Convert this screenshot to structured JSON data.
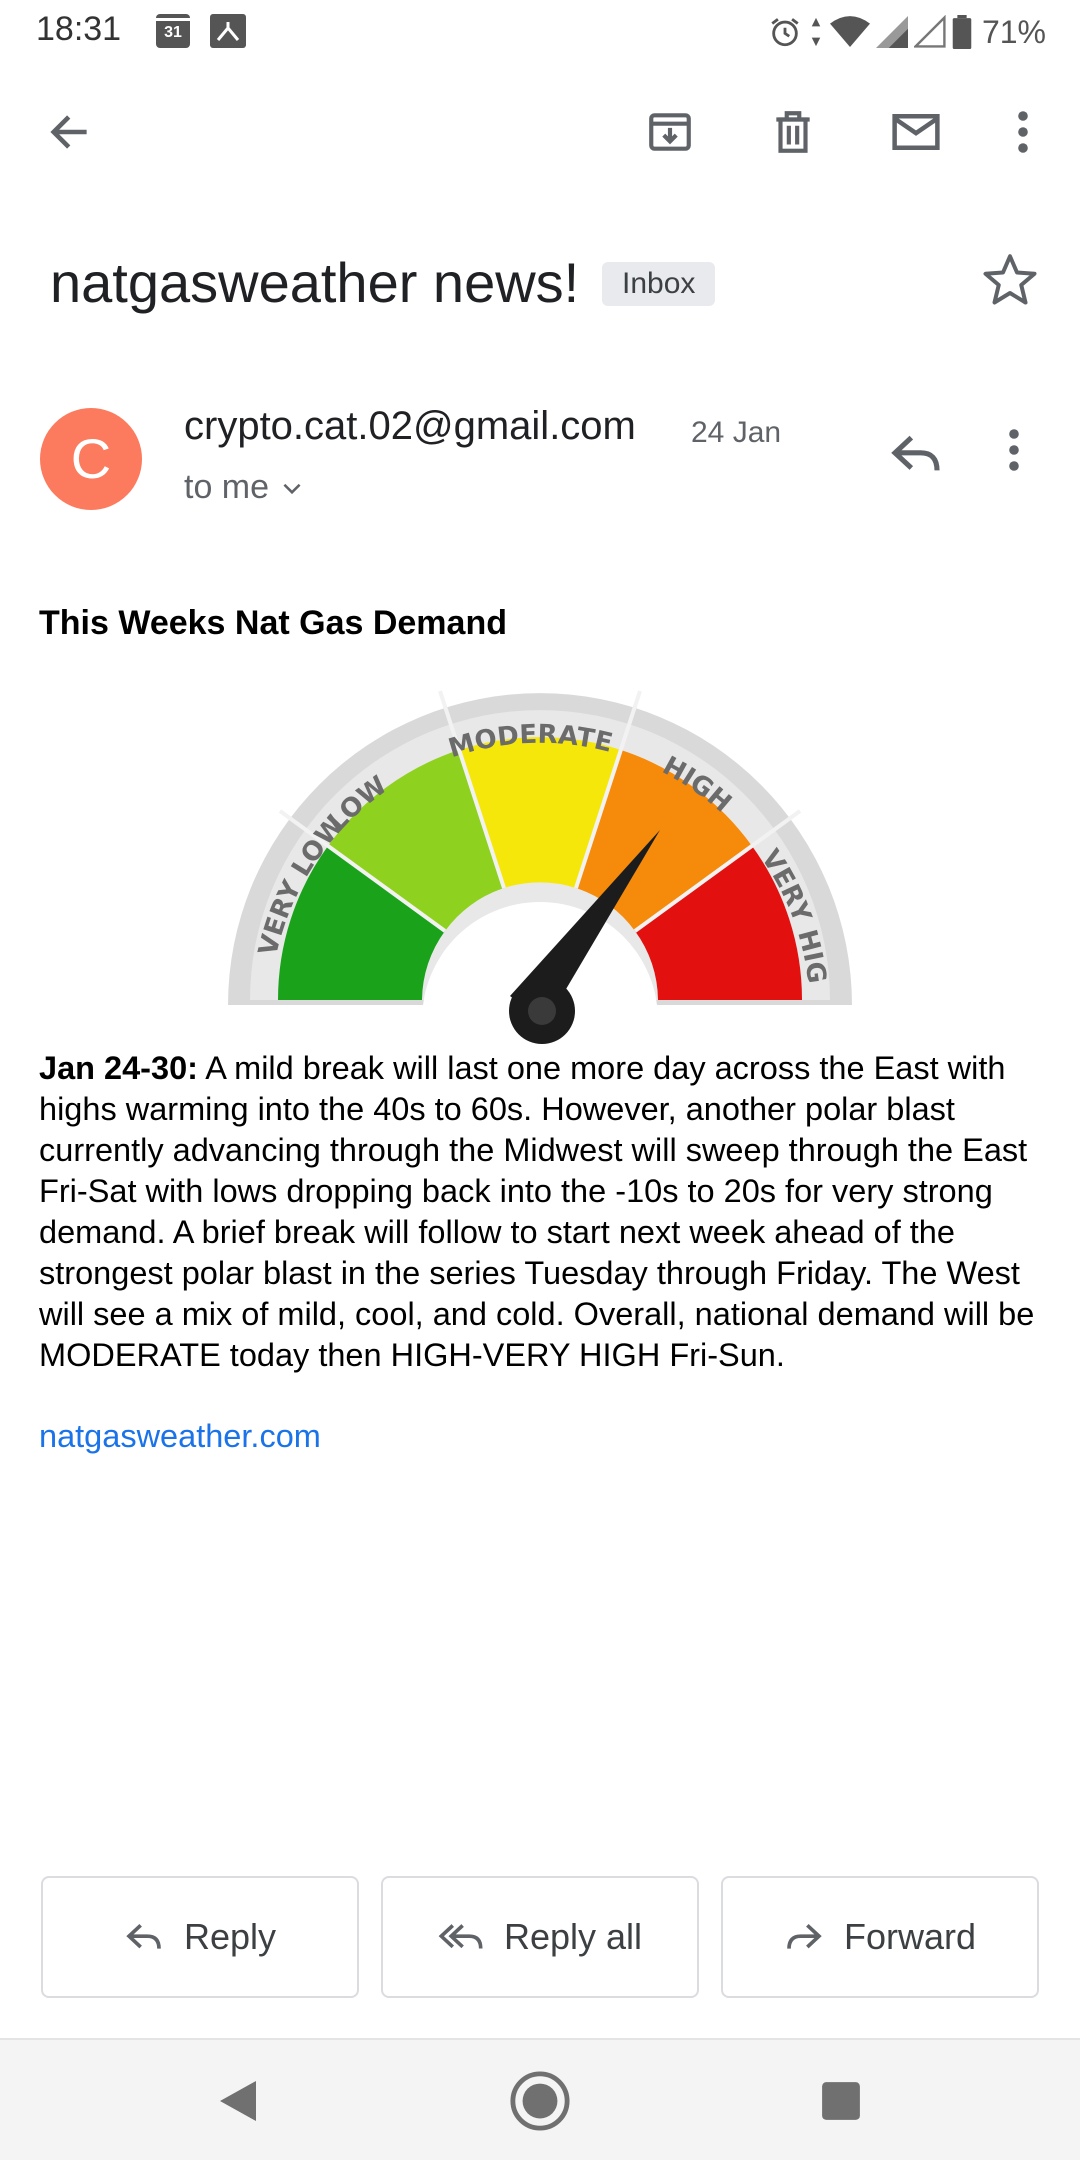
{
  "status_bar": {
    "time": "18:31",
    "calendar_day": "31",
    "battery": "71%"
  },
  "toolbar": {
    "back_icon": "arrow-left-icon",
    "archive_icon": "archive-icon",
    "delete_icon": "trash-icon",
    "mark_unread_icon": "mail-icon",
    "more_icon": "more-vert-icon"
  },
  "email": {
    "subject": "natgasweather news!",
    "label": "Inbox",
    "avatar_letter": "C",
    "avatar_color": "#fc7b5e",
    "sender": "crypto.cat.02@gmail.com",
    "date": "24 Jan",
    "recipient": "to me",
    "heading": "This Weeks Nat Gas Demand",
    "date_range": "Jan 24-30:",
    "paragraph": " A mild break will last one more day across the East with highs warming into the 40s to 60s. However, another polar blast currently advancing through the Midwest will sweep through the East Fri-Sat with lows dropping back into the -10s to 20s for very strong demand. A brief break will follow to start next week ahead of the strongest polar blast in the series Tuesday through Friday. The West will see a mix of mild, cool, and cold. Overall, national demand will be MODERATE today then HIGH-VERY HIGH Fri-Sun.",
    "link": "natgasweather.com",
    "link_color": "#1a73e8"
  },
  "gauge": {
    "segments": [
      "VERY LOW",
      "LOW",
      "MODERATE",
      "HIGH",
      "VERY HIGH"
    ],
    "colors": [
      "#1aa31a",
      "#8fd11f",
      "#f6e70a",
      "#f58a0b",
      "#e31010"
    ],
    "indicated_level": "HIGH"
  },
  "actions": {
    "reply": "Reply",
    "reply_all": "Reply all",
    "forward": "Forward"
  }
}
